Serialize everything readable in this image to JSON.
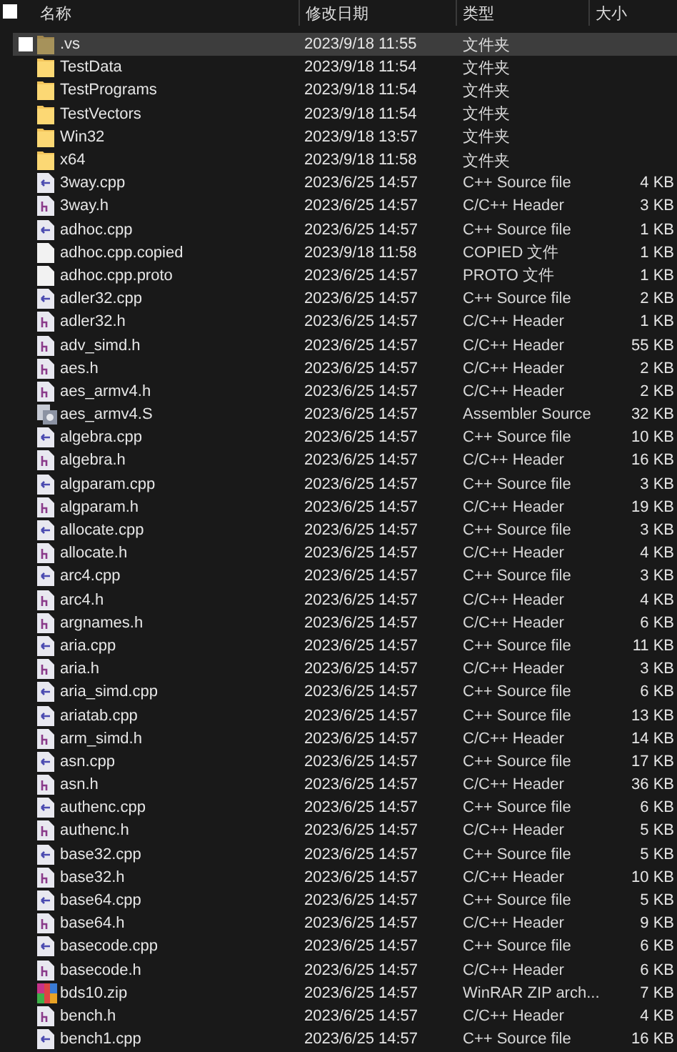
{
  "header": {
    "select_all": {
      "checked": false
    },
    "columns": [
      "名称",
      "修改日期",
      "类型",
      "大小"
    ]
  },
  "rows": [
    {
      "kind": "folder",
      "name": ".vs",
      "date": "2023/9/18 11:55",
      "type": "文件夹",
      "hidden": true,
      "selected": true,
      "checked": false
    },
    {
      "kind": "folder",
      "name": "TestData",
      "date": "2023/9/18 11:54",
      "type": "文件夹",
      "hidden": false,
      "selected": false,
      "checked": false
    },
    {
      "kind": "folder",
      "name": "TestPrograms",
      "date": "2023/9/18 11:54",
      "type": "文件夹",
      "hidden": false,
      "selected": false,
      "checked": false
    },
    {
      "kind": "folder",
      "name": "TestVectors",
      "date": "2023/9/18 11:54",
      "type": "文件夹",
      "hidden": false,
      "selected": false,
      "checked": false
    },
    {
      "kind": "folder",
      "name": "Win32",
      "date": "2023/9/18 13:57",
      "type": "文件夹",
      "hidden": false,
      "selected": false,
      "checked": false
    },
    {
      "kind": "folder",
      "name": "x64",
      "date": "2023/9/18 11:58",
      "type": "文件夹",
      "hidden": false,
      "selected": false,
      "checked": false
    },
    {
      "kind": "cpp",
      "name": "3way.cpp",
      "date": "2023/6/25 14:57",
      "type": "C++ Source file",
      "size": "4 KB",
      "hidden": false,
      "selected": false,
      "checked": false
    },
    {
      "kind": "h",
      "name": "3way.h",
      "date": "2023/6/25 14:57",
      "type": "C/C++ Header",
      "size": "3 KB",
      "hidden": false,
      "selected": false,
      "checked": false
    },
    {
      "kind": "cpp",
      "name": "adhoc.cpp",
      "date": "2023/6/25 14:57",
      "type": "C++ Source file",
      "size": "1 KB",
      "hidden": false,
      "selected": false,
      "checked": false
    },
    {
      "kind": "file",
      "name": "adhoc.cpp.copied",
      "date": "2023/9/18 11:58",
      "type": "COPIED 文件",
      "size": "1 KB",
      "hidden": false,
      "selected": false,
      "checked": false
    },
    {
      "kind": "file",
      "name": "adhoc.cpp.proto",
      "date": "2023/6/25 14:57",
      "type": "PROTO 文件",
      "size": "1 KB",
      "hidden": false,
      "selected": false,
      "checked": false
    },
    {
      "kind": "cpp",
      "name": "adler32.cpp",
      "date": "2023/6/25 14:57",
      "type": "C++ Source file",
      "size": "2 KB",
      "hidden": false,
      "selected": false,
      "checked": false
    },
    {
      "kind": "h",
      "name": "adler32.h",
      "date": "2023/6/25 14:57",
      "type": "C/C++ Header",
      "size": "1 KB",
      "hidden": false,
      "selected": false,
      "checked": false
    },
    {
      "kind": "h",
      "name": "adv_simd.h",
      "date": "2023/6/25 14:57",
      "type": "C/C++ Header",
      "size": "55 KB",
      "hidden": false,
      "selected": false,
      "checked": false
    },
    {
      "kind": "h",
      "name": "aes.h",
      "date": "2023/6/25 14:57",
      "type": "C/C++ Header",
      "size": "2 KB",
      "hidden": false,
      "selected": false,
      "checked": false
    },
    {
      "kind": "h",
      "name": "aes_armv4.h",
      "date": "2023/6/25 14:57",
      "type": "C/C++ Header",
      "size": "2 KB",
      "hidden": false,
      "selected": false,
      "checked": false
    },
    {
      "kind": "asm",
      "name": "aes_armv4.S",
      "date": "2023/6/25 14:57",
      "type": "Assembler Source",
      "size": "32 KB",
      "hidden": false,
      "selected": false,
      "checked": false
    },
    {
      "kind": "cpp",
      "name": "algebra.cpp",
      "date": "2023/6/25 14:57",
      "type": "C++ Source file",
      "size": "10 KB",
      "hidden": false,
      "selected": false,
      "checked": false
    },
    {
      "kind": "h",
      "name": "algebra.h",
      "date": "2023/6/25 14:57",
      "type": "C/C++ Header",
      "size": "16 KB",
      "hidden": false,
      "selected": false,
      "checked": false
    },
    {
      "kind": "cpp",
      "name": "algparam.cpp",
      "date": "2023/6/25 14:57",
      "type": "C++ Source file",
      "size": "3 KB",
      "hidden": false,
      "selected": false,
      "checked": false
    },
    {
      "kind": "h",
      "name": "algparam.h",
      "date": "2023/6/25 14:57",
      "type": "C/C++ Header",
      "size": "19 KB",
      "hidden": false,
      "selected": false,
      "checked": false
    },
    {
      "kind": "cpp",
      "name": "allocate.cpp",
      "date": "2023/6/25 14:57",
      "type": "C++ Source file",
      "size": "3 KB",
      "hidden": false,
      "selected": false,
      "checked": false
    },
    {
      "kind": "h",
      "name": "allocate.h",
      "date": "2023/6/25 14:57",
      "type": "C/C++ Header",
      "size": "4 KB",
      "hidden": false,
      "selected": false,
      "checked": false
    },
    {
      "kind": "cpp",
      "name": "arc4.cpp",
      "date": "2023/6/25 14:57",
      "type": "C++ Source file",
      "size": "3 KB",
      "hidden": false,
      "selected": false,
      "checked": false
    },
    {
      "kind": "h",
      "name": "arc4.h",
      "date": "2023/6/25 14:57",
      "type": "C/C++ Header",
      "size": "4 KB",
      "hidden": false,
      "selected": false,
      "checked": false
    },
    {
      "kind": "h",
      "name": "argnames.h",
      "date": "2023/6/25 14:57",
      "type": "C/C++ Header",
      "size": "6 KB",
      "hidden": false,
      "selected": false,
      "checked": false
    },
    {
      "kind": "cpp",
      "name": "aria.cpp",
      "date": "2023/6/25 14:57",
      "type": "C++ Source file",
      "size": "11 KB",
      "hidden": false,
      "selected": false,
      "checked": false
    },
    {
      "kind": "h",
      "name": "aria.h",
      "date": "2023/6/25 14:57",
      "type": "C/C++ Header",
      "size": "3 KB",
      "hidden": false,
      "selected": false,
      "checked": false
    },
    {
      "kind": "cpp",
      "name": "aria_simd.cpp",
      "date": "2023/6/25 14:57",
      "type": "C++ Source file",
      "size": "6 KB",
      "hidden": false,
      "selected": false,
      "checked": false
    },
    {
      "kind": "cpp",
      "name": "ariatab.cpp",
      "date": "2023/6/25 14:57",
      "type": "C++ Source file",
      "size": "13 KB",
      "hidden": false,
      "selected": false,
      "checked": false
    },
    {
      "kind": "h",
      "name": "arm_simd.h",
      "date": "2023/6/25 14:57",
      "type": "C/C++ Header",
      "size": "14 KB",
      "hidden": false,
      "selected": false,
      "checked": false
    },
    {
      "kind": "cpp",
      "name": "asn.cpp",
      "date": "2023/6/25 14:57",
      "type": "C++ Source file",
      "size": "17 KB",
      "hidden": false,
      "selected": false,
      "checked": false
    },
    {
      "kind": "h",
      "name": "asn.h",
      "date": "2023/6/25 14:57",
      "type": "C/C++ Header",
      "size": "36 KB",
      "hidden": false,
      "selected": false,
      "checked": false
    },
    {
      "kind": "cpp",
      "name": "authenc.cpp",
      "date": "2023/6/25 14:57",
      "type": "C++ Source file",
      "size": "6 KB",
      "hidden": false,
      "selected": false,
      "checked": false
    },
    {
      "kind": "h",
      "name": "authenc.h",
      "date": "2023/6/25 14:57",
      "type": "C/C++ Header",
      "size": "5 KB",
      "hidden": false,
      "selected": false,
      "checked": false
    },
    {
      "kind": "cpp",
      "name": "base32.cpp",
      "date": "2023/6/25 14:57",
      "type": "C++ Source file",
      "size": "5 KB",
      "hidden": false,
      "selected": false,
      "checked": false
    },
    {
      "kind": "h",
      "name": "base32.h",
      "date": "2023/6/25 14:57",
      "type": "C/C++ Header",
      "size": "10 KB",
      "hidden": false,
      "selected": false,
      "checked": false
    },
    {
      "kind": "cpp",
      "name": "base64.cpp",
      "date": "2023/6/25 14:57",
      "type": "C++ Source file",
      "size": "5 KB",
      "hidden": false,
      "selected": false,
      "checked": false
    },
    {
      "kind": "h",
      "name": "base64.h",
      "date": "2023/6/25 14:57",
      "type": "C/C++ Header",
      "size": "9 KB",
      "hidden": false,
      "selected": false,
      "checked": false
    },
    {
      "kind": "cpp",
      "name": "basecode.cpp",
      "date": "2023/6/25 14:57",
      "type": "C++ Source file",
      "size": "6 KB",
      "hidden": false,
      "selected": false,
      "checked": false
    },
    {
      "kind": "h",
      "name": "basecode.h",
      "date": "2023/6/25 14:57",
      "type": "C/C++ Header",
      "size": "6 KB",
      "hidden": false,
      "selected": false,
      "checked": false
    },
    {
      "kind": "zip",
      "name": "bds10.zip",
      "date": "2023/6/25 14:57",
      "type": "WinRAR ZIP arch...",
      "size": "7 KB",
      "hidden": false,
      "selected": false,
      "checked": false
    },
    {
      "kind": "h",
      "name": "bench.h",
      "date": "2023/6/25 14:57",
      "type": "C/C++ Header",
      "size": "4 KB",
      "hidden": false,
      "selected": false,
      "checked": false
    },
    {
      "kind": "cpp",
      "name": "bench1.cpp",
      "date": "2023/6/25 14:57",
      "type": "C++ Source file",
      "size": "16 KB",
      "hidden": false,
      "selected": false,
      "checked": false
    }
  ]
}
